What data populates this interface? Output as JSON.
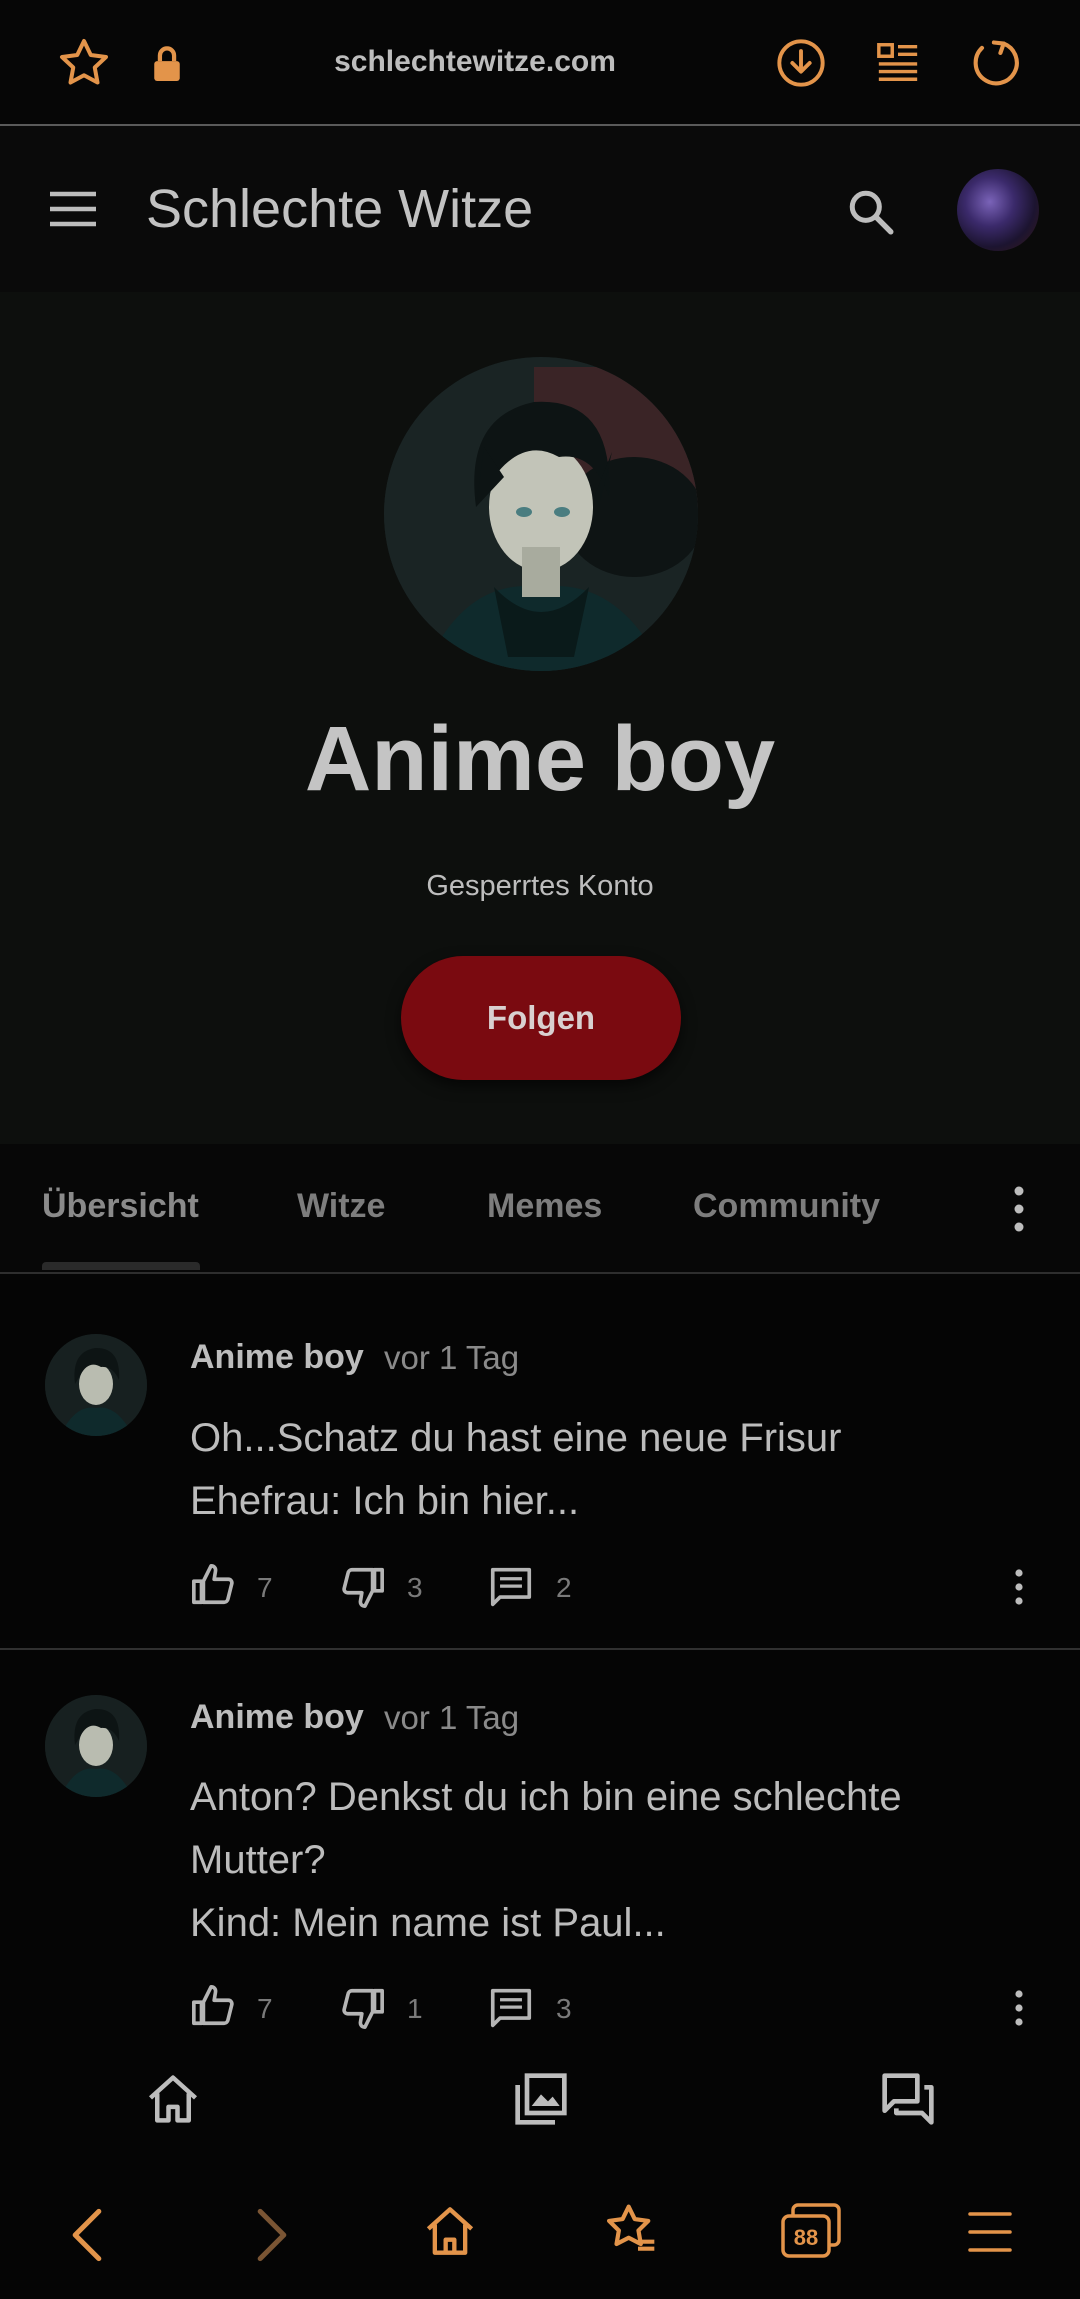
{
  "browser": {
    "url": "schlechtewitze.com",
    "tab_count": "88",
    "accent_color": "#e3944a"
  },
  "header": {
    "title": "Schlechte Witze"
  },
  "profile": {
    "name": "Anime boy",
    "status": "Gesperrtes Konto",
    "follow_label": "Folgen",
    "follow_color": "#7a0a10"
  },
  "tabs": [
    {
      "label": "Übersicht",
      "active": true
    },
    {
      "label": "Witze"
    },
    {
      "label": "Memes"
    },
    {
      "label": "Community"
    }
  ],
  "posts": [
    {
      "author": "Anime boy",
      "time": "vor 1 Tag",
      "lines": [
        "Oh...Schatz du hast eine neue Frisur",
        "Ehefrau: Ich bin hier..."
      ],
      "likes": "7",
      "dislikes": "3",
      "comments": "2"
    },
    {
      "author": "Anime boy",
      "time": "vor 1 Tag",
      "lines": [
        "Anton? Denkst du ich bin eine schlechte",
        "Mutter?",
        "Kind: Mein name ist Paul..."
      ],
      "likes": "7",
      "dislikes": "1",
      "comments": "3"
    }
  ]
}
